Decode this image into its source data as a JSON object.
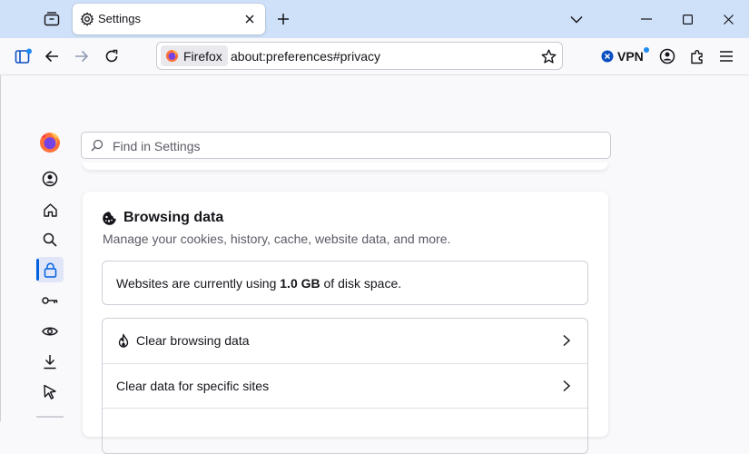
{
  "tab": {
    "title": "Settings"
  },
  "toolbar": {
    "identity_label": "Firefox",
    "url": "about:preferences#privacy",
    "vpn_label": "VPN"
  },
  "search": {
    "placeholder": "Find in Settings"
  },
  "browsing_data": {
    "title": "Browsing data",
    "description": "Manage your cookies, history, cache, website data, and more.",
    "usage_prefix": "Websites are currently using ",
    "usage_amount": "1.0 GB",
    "usage_suffix": " of disk space.",
    "clear_browsing_data": "Clear browsing data",
    "clear_site_data": "Clear data for specific sites"
  },
  "sidebar": {
    "items": [
      "account-icon",
      "home-icon",
      "search-icon",
      "lock-icon",
      "key-icon",
      "eye-icon",
      "download-icon",
      "cursor-icon"
    ],
    "selected": "lock-icon"
  },
  "colors": {
    "accent": "#0061e0",
    "tabstrip": "#cfe1f8"
  }
}
